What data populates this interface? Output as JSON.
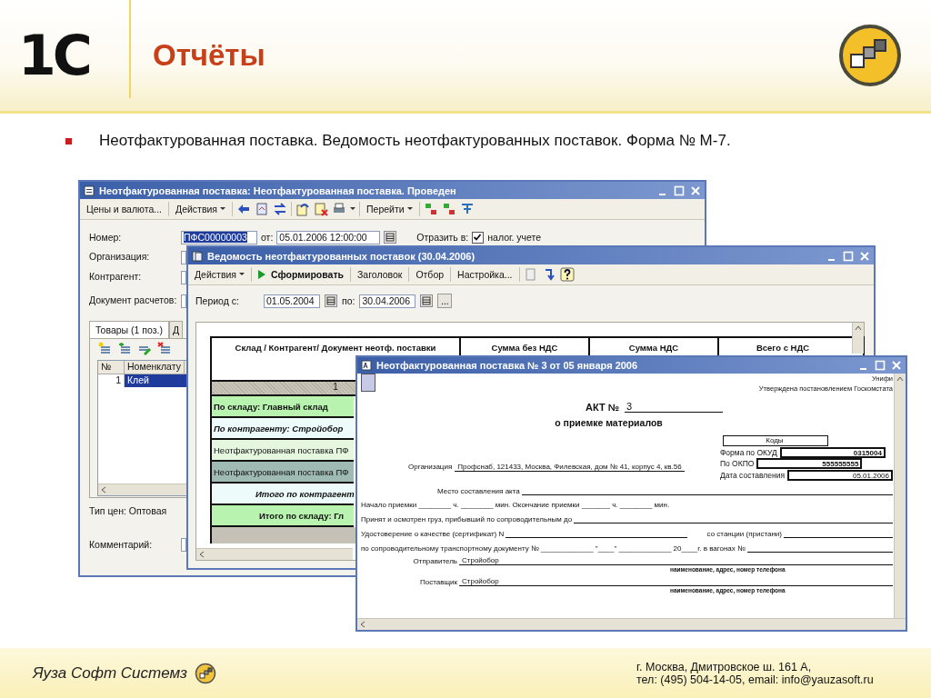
{
  "header": {
    "logo_text": "1С",
    "title": "Отчёты"
  },
  "bullet": "Неотфактурованная поставка. Ведомость неотфактурованных поставок. Форма № М-7.",
  "doc_window": {
    "title": "Неотфактурованная поставка: Неотфактурованная поставка. Проведен",
    "menus": [
      {
        "label": "Цены и валюта...",
        "dropdown": false
      },
      {
        "label": "Действия",
        "dropdown": true
      }
    ],
    "goto_menu": {
      "label": "Перейти",
      "dropdown": true
    },
    "number_label": "Номер:",
    "number_value": "ПФС00000003",
    "date_label": "от:",
    "date_value": "05.01.2006 12:00:00",
    "reflect_label": "Отразить в:",
    "tax": {
      "label": "налог. учете",
      "checked": true
    },
    "field_labels": [
      "Организация:",
      "Контрагент:",
      "Документ расчетов:"
    ],
    "tabs": [
      {
        "label": "Товары (1 поз.)",
        "selected": true
      },
      {
        "label": "Д",
        "selected": false
      }
    ],
    "columns": [
      "№",
      "Номенклату"
    ],
    "rows": [
      {
        "number": "1",
        "item": "Клей",
        "selected": true
      }
    ],
    "price_type": "Тип цен: Оптовая",
    "comment_label": "Комментарий:"
  },
  "report_window": {
    "title": "Ведомость неотфактурованных поставок (30.04.2006)",
    "actions": "Действия",
    "generate": "Сформировать",
    "buttons": [
      "Заголовок",
      "Отбор",
      "Настройка..."
    ],
    "period_label": "Период с:",
    "date_from": "01.05.2004",
    "to_label": "по:",
    "date_to": "30.04.2006",
    "more": "...",
    "columns": [
      "Склад / Контрагент/ Документ неотф. поставки",
      "Сумма без НДС",
      "Сумма НДС",
      "Всего с НДС"
    ],
    "column_number": "1",
    "rows": [
      {
        "kind": "warehouse",
        "text": "По складу: Главный склад",
        "selected": false
      },
      {
        "kind": "counterparty",
        "text": "По контрагенту: Стройобор",
        "selected": false
      },
      {
        "kind": "document",
        "text": "Неотфактурованная поставка ПФ",
        "selected": false
      },
      {
        "kind": "document",
        "text": "Неотфактурованная поставка ПФ",
        "selected": true
      },
      {
        "kind": "counterparty_total",
        "text": "Итого по контрагент",
        "selected": false
      },
      {
        "kind": "warehouse_total",
        "text": "Итого по складу: Гл",
        "selected": false
      }
    ]
  },
  "act_window": {
    "title": "Неотфактурованная поставка № 3 от 05 января 2006",
    "form_note": "Унифи",
    "approval": "Утверждена постановлением Госкомстата",
    "act_label": "АКТ №",
    "act_number": "3",
    "act_subtitle": "о приемке материалов",
    "codes_header": "Коды",
    "codes": [
      {
        "label": "Форма по ОКУД",
        "value": "0315004",
        "bold": true
      },
      {
        "label": "По ОКПО",
        "value": "555555555",
        "bold": true
      },
      {
        "label": "Дата составления",
        "value": "05.01.2006",
        "bold": false
      }
    ],
    "organization_label": "Организация",
    "organization_value": "Профснаб, 121433, Москва, Филевская, дом № 41, корпус 4, кв.56",
    "lines": [
      {
        "kind": "underline",
        "label": "Место составления акта"
      },
      {
        "kind": "plain",
        "label": "Начало приемки ________ ч. ________ мин. Окончание приемки _______ ч. ________ мин."
      },
      {
        "kind": "underline",
        "label": "Принят и осмотрен груз, прибывший по сопроводительным до"
      },
      {
        "kind": "pair",
        "label": "Удостоверение о качестве (сертификат) N",
        "second_label": "со станции (пристани)"
      },
      {
        "kind": "underline",
        "label": "по сопроводительному транспортному документу № _____________ \"____\" _____________ 20____г. в вагонах  №"
      },
      {
        "kind": "party",
        "label": "Отправитель",
        "value": "Стройобор",
        "caption": "наименование, адрес, номер телефона"
      },
      {
        "kind": "party",
        "label": "Поставщик",
        "value": "Стройобор",
        "caption": "наименование, адрес, номер телефона"
      }
    ]
  },
  "footer": {
    "company": "Яуза Софт Системз",
    "address": "г. Москва, Дмитровское ш. 161 А,",
    "contacts": "тел: (495) 504-14-05, email: info@yauzasoft.ru"
  }
}
